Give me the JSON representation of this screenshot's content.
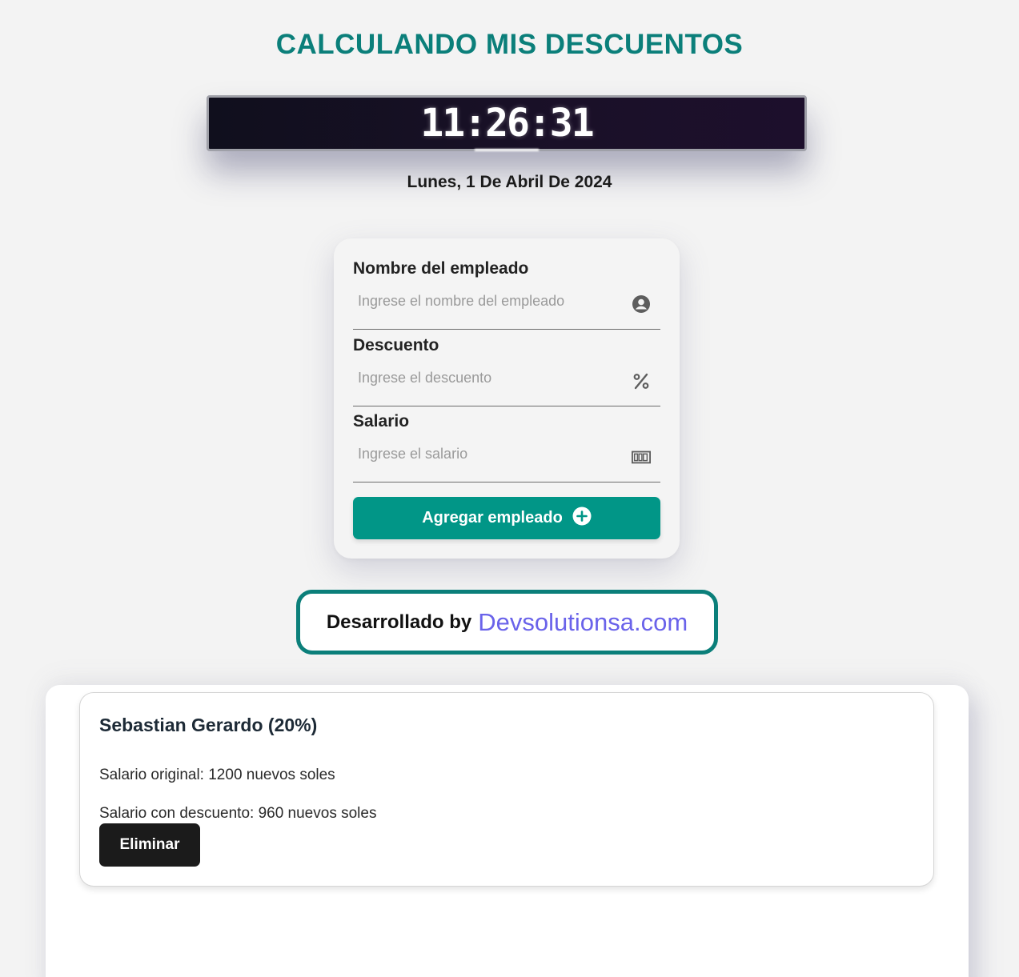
{
  "header": {
    "title": "CALCULANDO MIS DESCUENTOS",
    "clock_time": "11:26:31",
    "date": "Lunes, 1 De Abril De 2024"
  },
  "form": {
    "fields": [
      {
        "label": "Nombre del empleado",
        "placeholder": "Ingrese el nombre del empleado",
        "value": "",
        "icon": "user-circle-icon"
      },
      {
        "label": "Descuento",
        "placeholder": "Ingrese el descuento",
        "value": "",
        "icon": "percent-icon"
      },
      {
        "label": "Salario",
        "placeholder": "Ingrese el salario",
        "value": "",
        "icon": "money-bill-icon"
      }
    ],
    "submit_label": "Agregar empleado",
    "submit_icon": "plus-circle-icon"
  },
  "credit": {
    "prefix": "Desarrollado by",
    "link": "Devsolutionsa.com"
  },
  "employees": [
    {
      "title": "Sebastian Gerardo (20%)",
      "original": "Salario original: 1200 nuevos soles",
      "discounted": "Salario con descuento: 960 nuevos soles",
      "delete_label": "Eliminar"
    }
  ],
  "colors": {
    "accent": "#0b7f7a",
    "button": "#019687",
    "link": "#6a63ea",
    "background": "#f3f3f3"
  }
}
